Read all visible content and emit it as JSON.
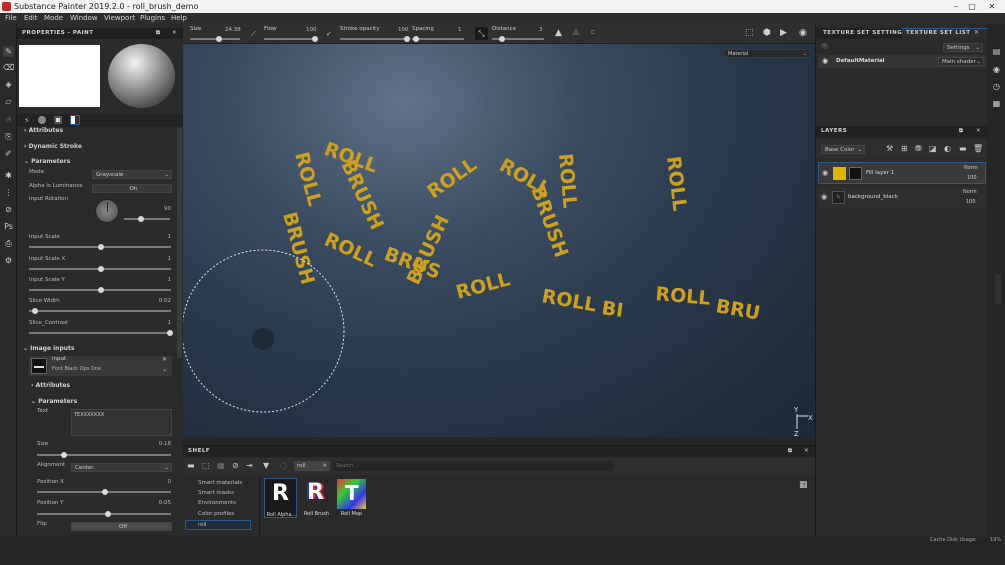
{
  "window": {
    "title": "Substance Painter 2019.2.0 - roll_brush_demo"
  },
  "menu": [
    "File",
    "Edit",
    "Mode",
    "Window",
    "Viewport",
    "Plugins",
    "Help"
  ],
  "toolbar": {
    "size": {
      "label": "Size",
      "value": "24.38"
    },
    "flow": {
      "label": "Flow",
      "value": "100"
    },
    "stroke_opacity": {
      "label": "Stroke opacity",
      "value": "100"
    },
    "spacing": {
      "label": "Spacing",
      "value": "1"
    },
    "distance": {
      "label": "Distance",
      "value": "3"
    }
  },
  "properties": {
    "title": "PROPERTIES - PAINT",
    "sections": {
      "attributes": "Attributes",
      "dynamic_stroke": "Dynamic Stroke",
      "parameters": "Parameters"
    },
    "mode": {
      "label": "Mode",
      "value": "Grayscale"
    },
    "alpha_luminance": {
      "label": "Alpha is Luminance",
      "value": "On"
    },
    "input_rotation": {
      "label": "Input Rotation",
      "value": "90"
    },
    "sliders": [
      {
        "label": "Input Scale",
        "value": "1"
      },
      {
        "label": "Input Scale X",
        "value": "1"
      },
      {
        "label": "Input Scale Y",
        "value": "1"
      },
      {
        "label": "Slice Width",
        "value": "0.02"
      },
      {
        "label": "Slice_Contrast",
        "value": "1"
      }
    ],
    "image_inputs": {
      "title": "Image inputs",
      "input_label": "input",
      "font_value": "Font Black Ops One"
    },
    "sub_attributes": "Attributes",
    "sub_parameters": "Parameters",
    "text": {
      "label": "Text",
      "value": "TEXXXXXXX"
    },
    "size": {
      "label": "Size",
      "value": "0.18"
    },
    "alignment": {
      "label": "Alignment",
      "value": "Center"
    },
    "position_x": {
      "label": "Position X",
      "value": "0"
    },
    "position_y": {
      "label": "Position Y",
      "value": "0.05"
    },
    "flip": {
      "label": "Flip",
      "value": "Off"
    }
  },
  "viewport": {
    "material_dropdown": "Material",
    "words": [
      "ROLL",
      "BRUSH",
      "ROLL",
      "BRUS",
      "ROLL",
      "BRUSH",
      "ROLL",
      "BRUSH",
      "ROLL",
      "BI",
      "ROLL",
      "BRU"
    ],
    "axis_y": "Y",
    "axis_x": "X",
    "axis_z": "Z"
  },
  "texture_set": {
    "tab1": "TEXTURE SET SETTINGS",
    "tab2": "TEXTURE SET LIST",
    "settings": "Settings",
    "material": "DefaultMaterial",
    "shader": "Main shader"
  },
  "layers": {
    "title": "LAYERS",
    "channel": "Base Color",
    "items": [
      {
        "name": "Fill layer 1",
        "blend": "Norm",
        "opacity": "100"
      },
      {
        "name": "background_black",
        "blend": "Norm",
        "opacity": "100"
      }
    ]
  },
  "shelf": {
    "title": "SHELF",
    "filter": "roll",
    "search_placeholder": "Search...",
    "categories": [
      "Smart materials",
      "Smart masks",
      "Environments",
      "Color profiles",
      "roll"
    ],
    "items": [
      {
        "label": "Roll Alpha..."
      },
      {
        "label": "Roll Brush"
      },
      {
        "label": "Roll Map"
      }
    ]
  },
  "status": {
    "cache": "Cache Disk Usage:",
    "percent": "19%"
  },
  "colors": {
    "accent": "#2d5a8a",
    "fill_layer_color": "#e0b400",
    "text_gold": "#d0a019"
  }
}
